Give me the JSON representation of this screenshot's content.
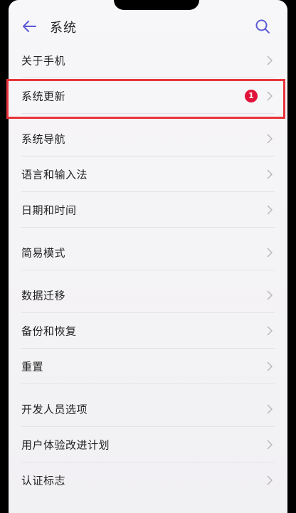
{
  "header": {
    "title": "系统",
    "back_icon": "back-arrow-icon",
    "search_icon": "search-icon",
    "accent_color": "#5b5bd6"
  },
  "items": [
    {
      "label": "关于手机"
    },
    {
      "label": "系统更新",
      "badge": "1"
    },
    {
      "label": "系统导航"
    },
    {
      "label": "语言和输入法"
    },
    {
      "label": "日期和时间"
    },
    {
      "label": "简易模式"
    },
    {
      "label": "数据迁移"
    },
    {
      "label": "备份和恢复"
    },
    {
      "label": "重置"
    },
    {
      "label": "开发人员选项"
    },
    {
      "label": "用户体验改进计划"
    },
    {
      "label": "认证标志"
    }
  ],
  "colors": {
    "badge": "#e1133a",
    "highlight_box": "#e8333b"
  }
}
